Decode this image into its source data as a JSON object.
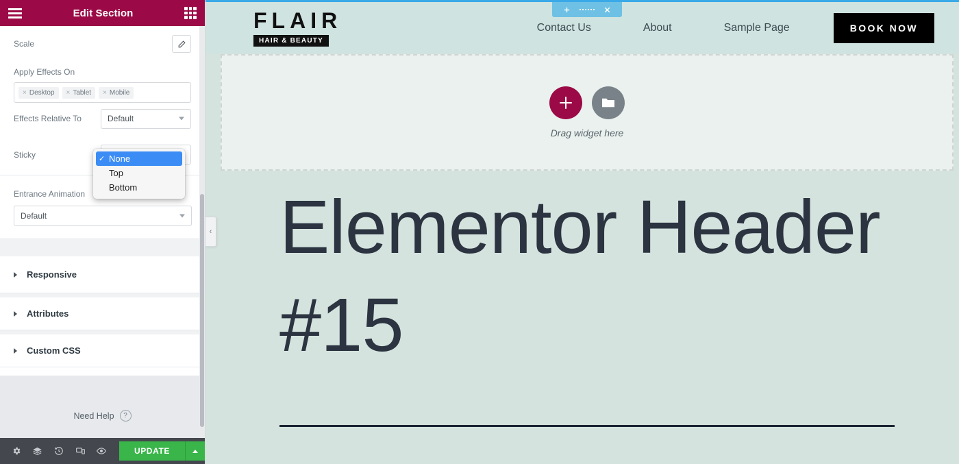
{
  "panel": {
    "header": {
      "title": "Edit Section",
      "menu_icon": "hamburger-icon",
      "widgets_icon": "grid-icon"
    },
    "scale": {
      "label": "Scale",
      "edit_icon": "pencil-icon"
    },
    "apply_effects": {
      "label": "Apply Effects On",
      "tags": [
        {
          "remove": "×",
          "label": "Desktop"
        },
        {
          "remove": "×",
          "label": "Tablet"
        },
        {
          "remove": "×",
          "label": "Mobile"
        }
      ]
    },
    "effects_relative": {
      "label": "Effects Relative To",
      "value": "Default"
    },
    "sticky": {
      "label": "Sticky",
      "value": "None",
      "options": [
        {
          "label": "None",
          "selected": true,
          "check": "✓"
        },
        {
          "label": "Top",
          "selected": false,
          "check": ""
        },
        {
          "label": "Bottom",
          "selected": false,
          "check": ""
        }
      ]
    },
    "entrance_animation": {
      "label": "Entrance Animation",
      "value": "Default"
    },
    "accordions": [
      {
        "label": "Responsive"
      },
      {
        "label": "Attributes"
      },
      {
        "label": "Custom CSS"
      }
    ],
    "need_help": {
      "label": "Need Help",
      "icon": "question-circle-icon"
    },
    "footer": {
      "icons": [
        {
          "name": "settings-gear-icon"
        },
        {
          "name": "navigator-layers-icon"
        },
        {
          "name": "history-clock-icon"
        },
        {
          "name": "responsive-devices-icon"
        },
        {
          "name": "preview-eye-icon"
        }
      ],
      "update_label": "UPDATE",
      "update_caret_icon": "caret-up-icon"
    }
  },
  "canvas": {
    "section_tab": {
      "add_icon": "plus-icon",
      "drag_icon": "dots-grid-icon",
      "close_icon": "close-x-icon"
    },
    "logo": {
      "word": "FLAIR",
      "sub": "HAIR & BEAUTY"
    },
    "nav": [
      {
        "label": "Contact Us"
      },
      {
        "label": "About"
      },
      {
        "label": "Sample Page"
      }
    ],
    "cta": {
      "label": "BOOK NOW"
    },
    "dropzone": {
      "text": "Drag widget here",
      "add_widget_icon": "plus-circle-icon",
      "template_icon": "folder-icon"
    },
    "hero": {
      "title": "Elementor Header #15"
    },
    "collapse_handle": {
      "icon": "chevron-left-icon",
      "glyph": "‹"
    }
  },
  "colors": {
    "panel_header": "#9b0a46",
    "accent_crimson": "#9b0a46",
    "update_green": "#39b54a",
    "section_tab_blue": "#6ec1e4",
    "select_highlight": "#3b8cf4",
    "canvas_bg": "#d5e3de",
    "header_bg": "#cfe3e0"
  }
}
